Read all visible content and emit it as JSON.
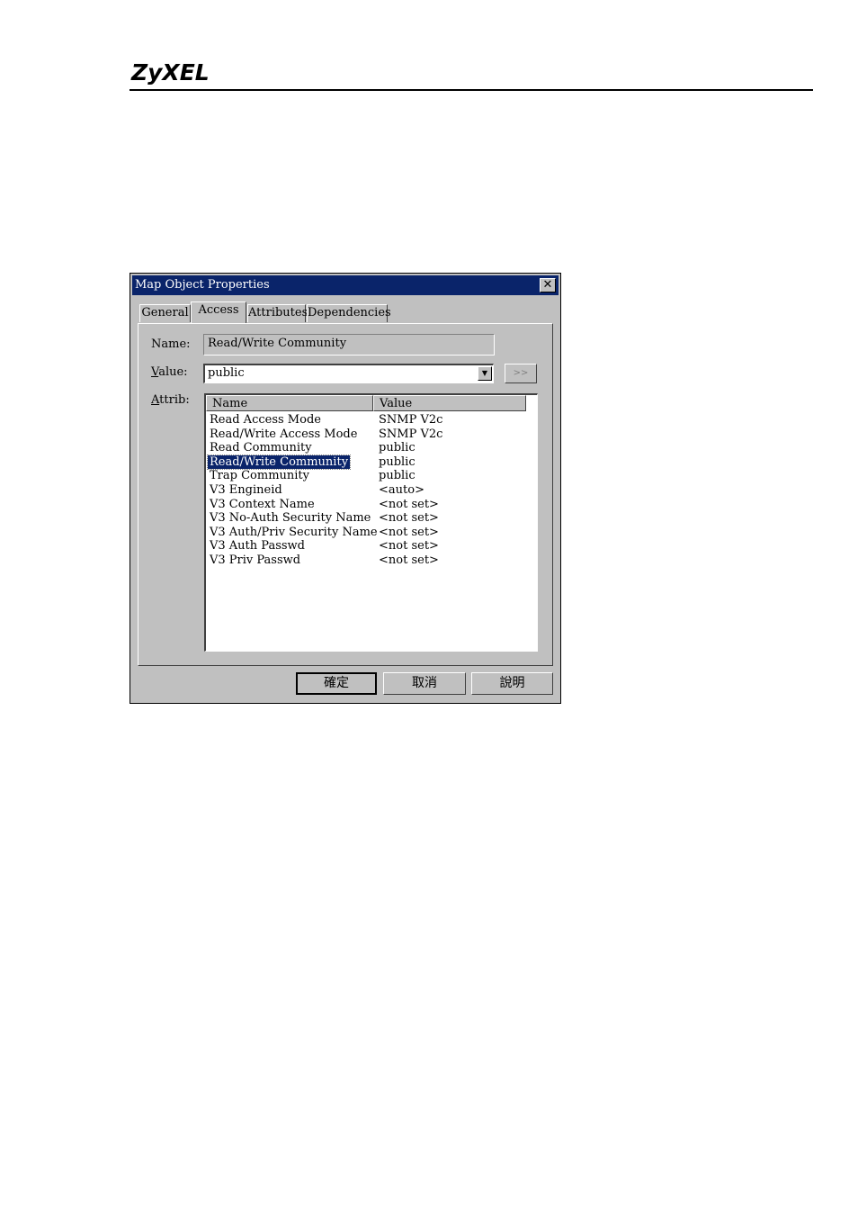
{
  "brand": {
    "logo": "ZyXEL"
  },
  "dialog": {
    "title": "Map Object Properties",
    "close_glyph": "✕",
    "tabs": [
      {
        "label": "General",
        "active": false
      },
      {
        "label": "Access",
        "active": true
      },
      {
        "label": "Attributes",
        "active": false
      },
      {
        "label": "Dependencies",
        "active": false
      }
    ],
    "name_label": "Name:",
    "name_value": "Read/Write Community",
    "value_label_first": "V",
    "value_label_rest": "alue:",
    "value_value": "public",
    "more_button": ">>",
    "attrib_label_first": "A",
    "attrib_label_rest": "ttrib:",
    "list": {
      "columns": [
        "Name",
        "Value"
      ],
      "rows": [
        {
          "name": "Read Access Mode",
          "value": "SNMP V2c"
        },
        {
          "name": "Read/Write Access Mode",
          "value": "SNMP V2c"
        },
        {
          "name": "Read Community",
          "value": "public"
        },
        {
          "name": "Read/Write Community",
          "value": "public",
          "selected": true
        },
        {
          "name": "Trap Community",
          "value": "public"
        },
        {
          "name": "V3 Engineid",
          "value": "<auto>"
        },
        {
          "name": "V3 Context Name",
          "value": "<not set>"
        },
        {
          "name": "V3 No-Auth Security Name",
          "value": "<not set>"
        },
        {
          "name": "V3 Auth/Priv Security Name",
          "value": "<not set>"
        },
        {
          "name": "V3 Auth Passwd",
          "value": "<not set>"
        },
        {
          "name": "V3 Priv Passwd",
          "value": "<not set>"
        }
      ]
    },
    "buttons": {
      "ok": "確定",
      "cancel": "取消",
      "help": "說明"
    },
    "colors": {
      "titlebar": "#0a246a",
      "face": "#c0c0c0",
      "selection": "#0a246a"
    }
  }
}
